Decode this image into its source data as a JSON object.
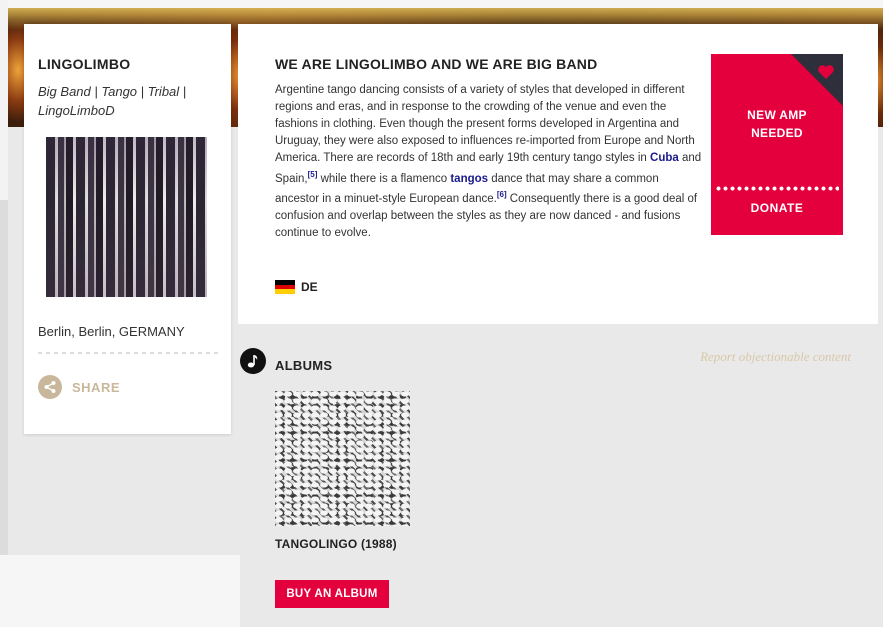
{
  "artist": {
    "name": "LINGOLIMBO",
    "genres": "Big Band | Tango | Tribal | LingoLimboD",
    "location": "Berlin, Berlin, GERMANY",
    "share_label": "SHARE"
  },
  "about": {
    "title": "WE ARE LINGOLIMBO AND WE ARE BIG BAND",
    "text_part1": "Argentine tango dancing consists of a variety of styles that developed in different regions and eras, and in response to the crowding of the venue and even the fashions in clothing. Even though the present forms developed in Argentina and Uruguay, they were also exposed to influences re-imported from Europe and North America. There are records of 18th and early 19th century tango styles in ",
    "link_cuba": "Cuba",
    "text_part2": " and Spain,",
    "ref1": "[5]",
    "text_part3": " while there is a flamenco ",
    "link_tangos": "tangos",
    "text_part4": " dance that may share a common ancestor in a minuet-style European dance.",
    "ref2": "[6]",
    "text_part5": " Consequently there is a good deal of confusion and overlap between the styles as they are now danced - and fusions continue to evolve.",
    "language": "DE"
  },
  "donate": {
    "line1": "NEW AMP",
    "line2": "NEEDED",
    "button_label": "DONATE"
  },
  "albums": {
    "heading": "ALBUMS",
    "report_link": "Report objectionable content",
    "items": [
      {
        "title": "TANGOLINGO (1988)"
      }
    ],
    "buy_label": "BUY AN ALBUM"
  },
  "colors": {
    "accent": "#e4003d",
    "dark": "#2e2f3a",
    "muted": "#c9b79b"
  }
}
